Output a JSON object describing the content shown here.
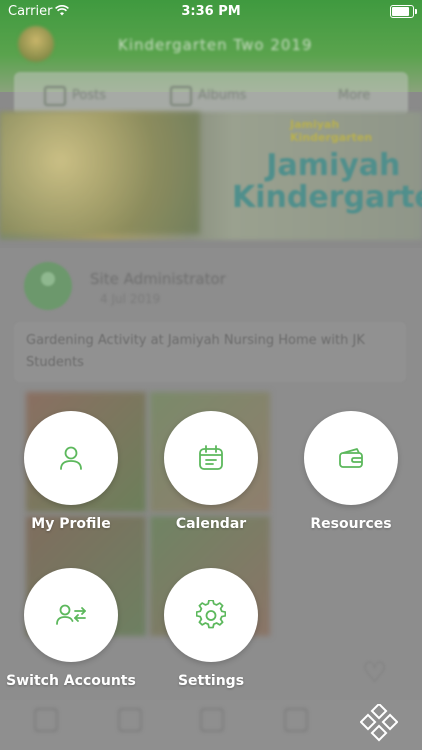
{
  "status_bar": {
    "carrier": "Carrier",
    "time": "3:36 PM"
  },
  "background": {
    "header_title": "Kindergarten Two 2019",
    "tabs": [
      "Posts",
      "Albums",
      "More"
    ],
    "banner_small_text": "Jamiyah Kindergarten",
    "banner_brand": "Jamiyah Kindergarte",
    "post_author": "Site Administrator",
    "post_date": "4 Jul 2019",
    "post_text": "Gardening Activity at Jamiyah Nursing Home with JK Students"
  },
  "menu": {
    "items": [
      {
        "label": "My Profile",
        "icon": "user-icon"
      },
      {
        "label": "Calendar",
        "icon": "calendar-icon"
      },
      {
        "label": "Resources",
        "icon": "wallet-icon"
      },
      {
        "label": "Switch Accounts",
        "icon": "switch-user-icon"
      },
      {
        "label": "Settings",
        "icon": "gear-icon"
      }
    ]
  },
  "colors": {
    "accent": "#5cb85c",
    "menu_circle": "#ffffff",
    "header": "#4a9f48"
  }
}
